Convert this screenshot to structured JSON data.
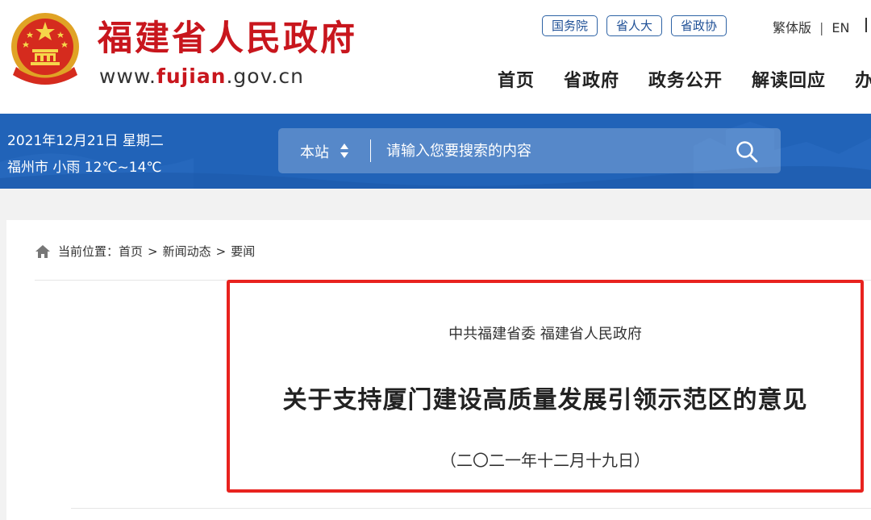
{
  "site": {
    "title": "福建省人民政府",
    "url_prefix": "www.",
    "url_highlight": "fujian",
    "url_suffix": ".gov.cn"
  },
  "top_links": [
    "国务院",
    "省人大",
    "省政协"
  ],
  "lang": {
    "traditional": "繁体版",
    "separator": "|",
    "english": "EN"
  },
  "main_nav": [
    "首页",
    "省政府",
    "政务公开",
    "解读回应",
    "办"
  ],
  "info": {
    "date": "2021年12月21日 星期二",
    "weather": "福州市 小雨 12℃~14℃"
  },
  "search": {
    "scope": "本站",
    "placeholder": "请输入您要搜索的内容",
    "button_icon": "search-icon"
  },
  "breadcrumb": {
    "label": "当前位置：",
    "items": [
      "首页",
      "新闻动态",
      "要闻"
    ],
    "separator": ">"
  },
  "article": {
    "issuer": "中共福建省委 福建省人民政府",
    "title": "关于支持厦门建设高质量发展引领示范区的意见",
    "date": "（二〇二一年十二月十九日）"
  },
  "colors": {
    "brand_red": "#c8161d",
    "band_blue": "#2163b8",
    "link_blue": "#1e4f96",
    "highlight_red": "#e8221e"
  }
}
